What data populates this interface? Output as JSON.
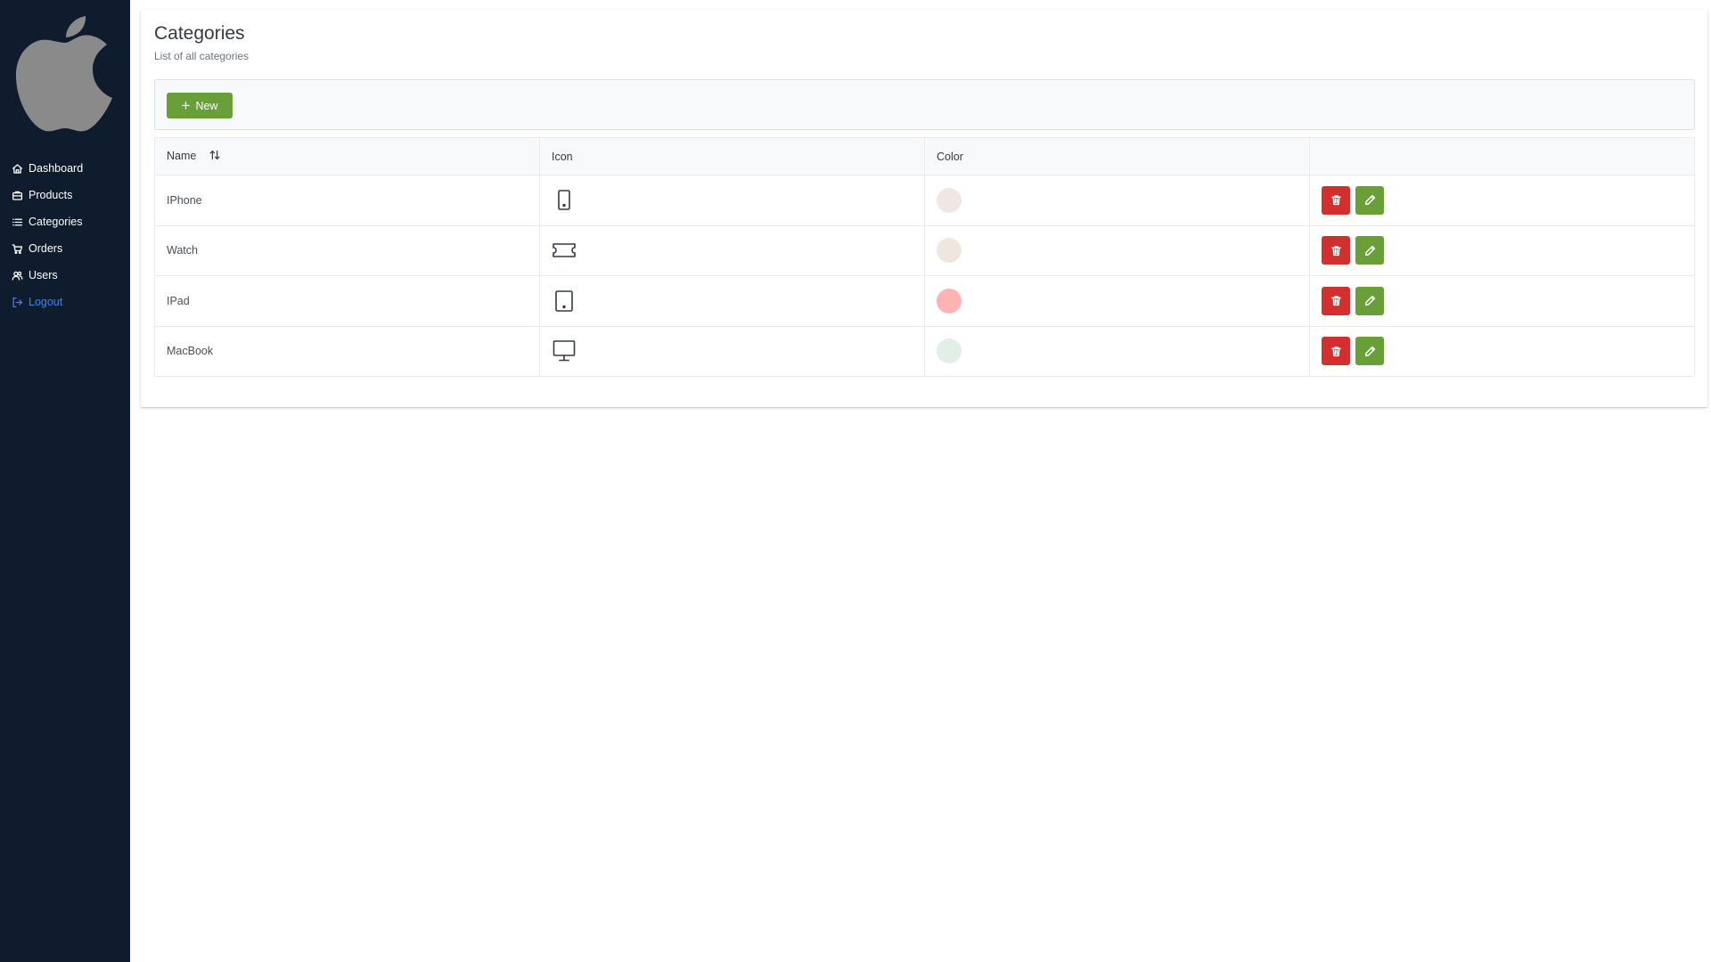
{
  "sidebar": {
    "logo": "apple-logo",
    "items": [
      {
        "label": "Dashboard",
        "icon": "home-icon"
      },
      {
        "label": "Products",
        "icon": "briefcase-icon"
      },
      {
        "label": "Categories",
        "icon": "list-icon"
      },
      {
        "label": "Orders",
        "icon": "cart-icon"
      },
      {
        "label": "Users",
        "icon": "users-icon"
      },
      {
        "label": "Logout",
        "icon": "logout-icon"
      }
    ]
  },
  "page": {
    "title": "Categories",
    "subtitle": "List of all categories"
  },
  "toolbar": {
    "new_label": "New"
  },
  "table": {
    "columns": [
      "Name",
      "Icon",
      "Color",
      ""
    ],
    "rows": [
      {
        "name": "IPhone",
        "icon": "mobile-icon",
        "color": "#f0e6e4"
      },
      {
        "name": "Watch",
        "icon": "ticket-icon",
        "color": "#f0e6e0"
      },
      {
        "name": "IPad",
        "icon": "tablet-icon",
        "color": "#ffb3b3"
      },
      {
        "name": "MacBook",
        "icon": "desktop-icon",
        "color": "#e1efe6"
      }
    ]
  },
  "colors": {
    "sidebar_bg": "#0f1c2e",
    "accent_green": "#689f38",
    "danger_red": "#d32f2f",
    "logout_link": "#3b82f6"
  }
}
